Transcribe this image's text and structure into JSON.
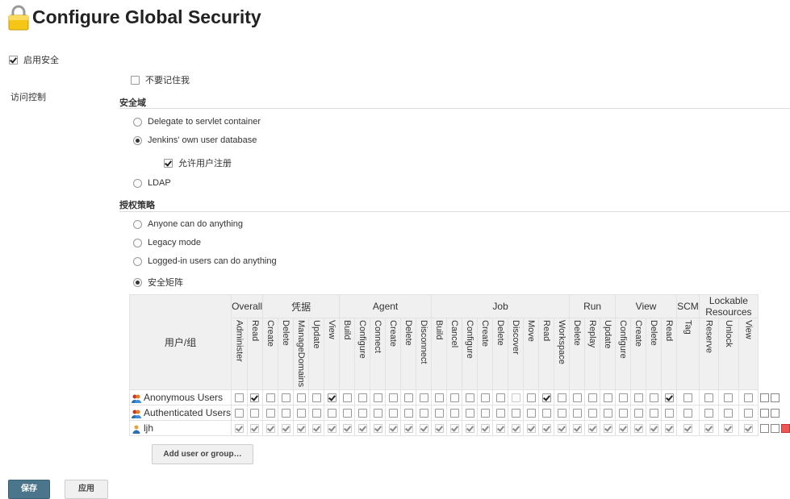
{
  "page": {
    "title": "Configure Global Security"
  },
  "enable_security": {
    "label": "启用安全",
    "checked": true
  },
  "remember_me": {
    "label": "不要记住我",
    "checked": false
  },
  "access_control": {
    "label": "访问控制"
  },
  "realm": {
    "heading": "安全域",
    "options": [
      {
        "label": "Delegate to servlet container",
        "selected": false
      },
      {
        "label": "Jenkins' own user database",
        "selected": true
      },
      {
        "label": "LDAP",
        "selected": false
      }
    ],
    "allow_signup": {
      "label": "允许用户注册",
      "checked": true
    }
  },
  "authorization": {
    "heading": "授权策略",
    "options": [
      {
        "label": "Anyone can do anything",
        "selected": false
      },
      {
        "label": "Legacy mode",
        "selected": false
      },
      {
        "label": "Logged-in users can do anything",
        "selected": false
      },
      {
        "label": "安全矩阵",
        "selected": true
      }
    ]
  },
  "matrix": {
    "user_header": "用户/组",
    "groups": [
      {
        "name": "Overall",
        "span": 2
      },
      {
        "name": "凭据",
        "span": 5
      },
      {
        "name": "Agent",
        "span": 6
      },
      {
        "name": "Job",
        "span": 9
      },
      {
        "name": "Run",
        "span": 3
      },
      {
        "name": "View",
        "span": 4
      },
      {
        "name": "SCM",
        "span": 1
      },
      {
        "name": "Lockable Resources",
        "span": 3
      }
    ],
    "permissions": [
      "Administer",
      "Read",
      "Create",
      "Delete",
      "ManageDomains",
      "Update",
      "View",
      "Build",
      "Configure",
      "Connect",
      "Create",
      "Delete",
      "Disconnect",
      "Build",
      "Cancel",
      "Configure",
      "Create",
      "Delete",
      "Discover",
      "Move",
      "Read",
      "Workspace",
      "Delete",
      "Replay",
      "Update",
      "Configure",
      "Create",
      "Delete",
      "Read",
      "Tag",
      "Reserve",
      "Unlock",
      "View"
    ],
    "rows": [
      {
        "name": "Anonymous Users",
        "icon": "group-icon",
        "checked": [
          1,
          6,
          20,
          28
        ],
        "disabled": [
          18
        ],
        "all_dim": false,
        "actions": [
          "copy-icon",
          "copy-icon"
        ]
      },
      {
        "name": "Authenticated Users",
        "icon": "group-icon",
        "checked": [],
        "disabled": [],
        "all_dim": false,
        "actions": [
          "copy-icon",
          "copy-icon"
        ]
      },
      {
        "name": "ljh",
        "icon": "user-icon",
        "checked": "all",
        "disabled": [],
        "all_dim": true,
        "actions": [
          "copy-icon",
          "copy-icon",
          "delete-icon"
        ]
      }
    ],
    "add_button": "Add user or group…"
  },
  "buttons": {
    "save": "保存",
    "apply": "应用"
  },
  "colors": {
    "primary_button": "#4b758b",
    "header_bg": "#f0f0f0"
  }
}
